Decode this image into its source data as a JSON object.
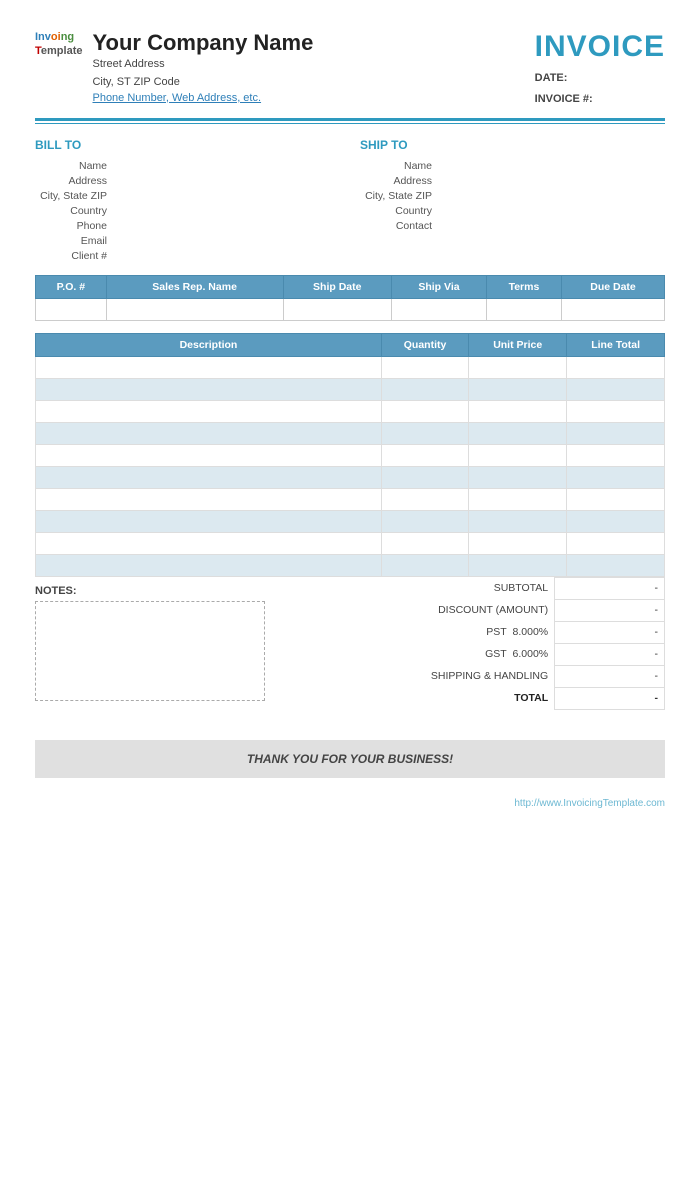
{
  "header": {
    "logo_inv": "Inv",
    "logo_oi": "oi",
    "logo_ng": "ng",
    "logo_tem": "T",
    "logo_emplate": "emplate",
    "company_name": "Your Company Name",
    "street_address": "Street Address",
    "city_state_zip": "City, ST  ZIP Code",
    "phone_web": "Phone Number, Web Address, etc.",
    "invoice_title": "INVOICE",
    "date_label": "DATE:",
    "date_value": "",
    "invoice_num_label": "INVOICE #:",
    "invoice_num_value": ""
  },
  "bill_to": {
    "section_title": "BILL TO",
    "name_label": "Name",
    "name_value": "",
    "address_label": "Address",
    "address_value": "",
    "city_label": "City, State ZIP",
    "city_value": "",
    "country_label": "Country",
    "country_value": "",
    "phone_label": "Phone",
    "phone_value": "",
    "email_label": "Email",
    "email_value": "",
    "client_label": "Client #",
    "client_value": ""
  },
  "ship_to": {
    "section_title": "SHIP TO",
    "name_label": "Name",
    "name_value": "",
    "address_label": "Address",
    "address_value": "",
    "city_label": "City, State ZIP",
    "city_value": "",
    "country_label": "Country",
    "country_value": "",
    "contact_label": "Contact",
    "contact_value": ""
  },
  "order_info": {
    "columns": [
      "P.O. #",
      "Sales Rep. Name",
      "Ship Date",
      "Ship Via",
      "Terms",
      "Due Date"
    ],
    "values": [
      "",
      "",
      "",
      "",
      "",
      ""
    ]
  },
  "items": {
    "col_description": "Description",
    "col_quantity": "Quantity",
    "col_unit_price": "Unit Price",
    "col_line_total": "Line Total",
    "rows": [
      {
        "desc": "",
        "qty": "",
        "unit": "",
        "total": ""
      },
      {
        "desc": "",
        "qty": "",
        "unit": "",
        "total": ""
      },
      {
        "desc": "",
        "qty": "",
        "unit": "",
        "total": ""
      },
      {
        "desc": "",
        "qty": "",
        "unit": "",
        "total": ""
      },
      {
        "desc": "",
        "qty": "",
        "unit": "",
        "total": ""
      },
      {
        "desc": "",
        "qty": "",
        "unit": "",
        "total": ""
      },
      {
        "desc": "",
        "qty": "",
        "unit": "",
        "total": ""
      },
      {
        "desc": "",
        "qty": "",
        "unit": "",
        "total": ""
      },
      {
        "desc": "",
        "qty": "",
        "unit": "",
        "total": ""
      },
      {
        "desc": "",
        "qty": "",
        "unit": "",
        "total": ""
      }
    ]
  },
  "totals": {
    "subtotal_label": "SUBTOTAL",
    "subtotal_value": "-",
    "discount_label": "DISCOUNT (AMOUNT)",
    "discount_value": "-",
    "pst_label": "PST",
    "pst_rate": "8.000%",
    "pst_value": "-",
    "gst_label": "GST",
    "gst_rate": "6.000%",
    "gst_value": "-",
    "shipping_label": "SHIPPING & HANDLING",
    "shipping_value": "-",
    "total_label": "TOTAL",
    "total_value": "-"
  },
  "notes": {
    "label": "NOTES:"
  },
  "footer": {
    "thank_you": "THANK YOU FOR YOUR BUSINESS!",
    "watermark": "http://www.InvoicingTemplate.com"
  }
}
